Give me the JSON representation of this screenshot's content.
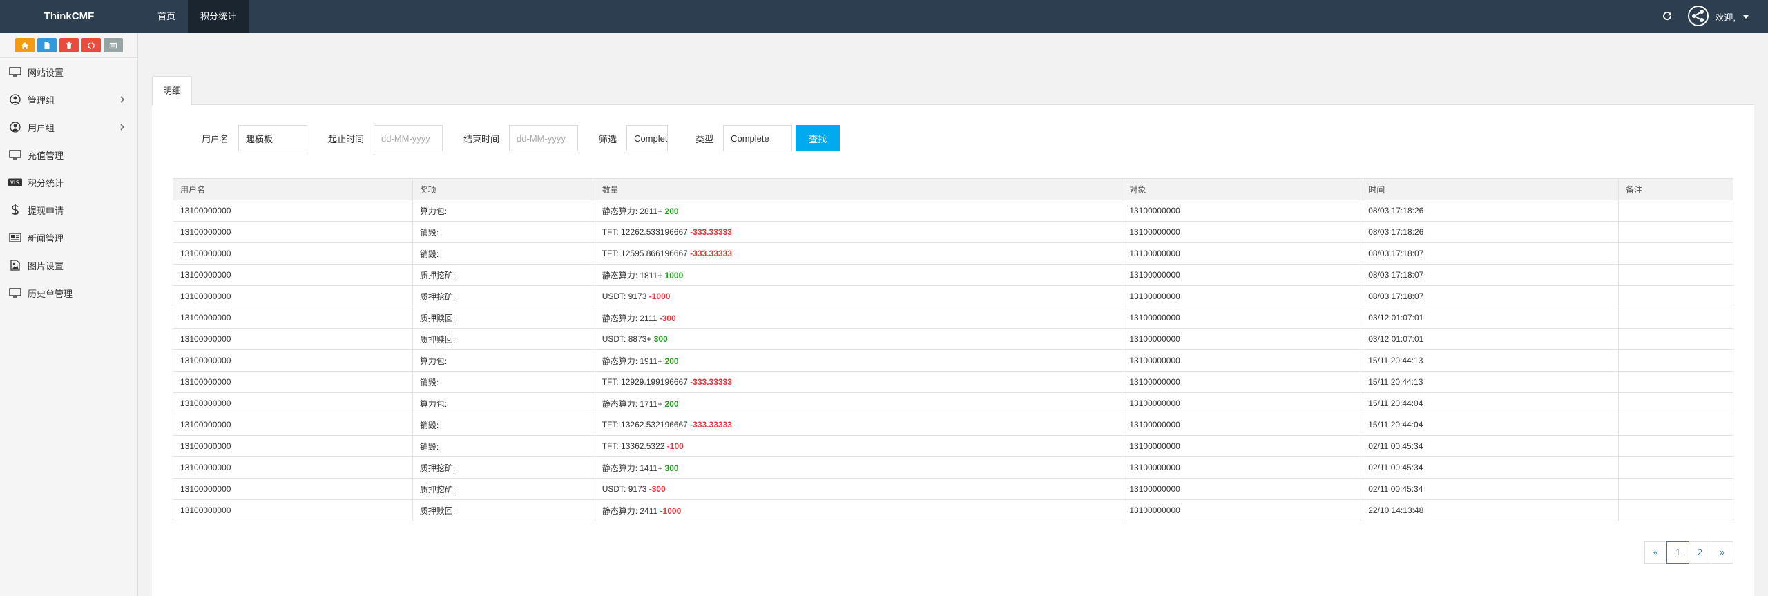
{
  "topbar": {
    "brand": "ThinkCMF",
    "nav": [
      {
        "label": "首页",
        "active": false
      },
      {
        "label": "积分统计",
        "active": true
      }
    ],
    "user_label": "欢迎,"
  },
  "sidebar": {
    "shortcuts": [
      {
        "icon": "home-icon",
        "color": "#f39c12"
      },
      {
        "icon": "file-icon",
        "color": "#3498db"
      },
      {
        "icon": "trash-icon",
        "color": "#e74c3c"
      },
      {
        "icon": "recycle-icon",
        "color": "#e74c3c"
      },
      {
        "icon": "list-icon",
        "color": "#95a5a6"
      }
    ],
    "items": [
      {
        "label": "网站设置",
        "icon": "monitor-icon",
        "has_children": false
      },
      {
        "label": "管理组",
        "icon": "user-circle-icon",
        "has_children": true
      },
      {
        "label": "用户组",
        "icon": "user-circle-icon",
        "has_children": true
      },
      {
        "label": "充值管理",
        "icon": "monitor-icon",
        "has_children": false
      },
      {
        "label": "积分统计",
        "icon": "visa-card-icon",
        "has_children": false
      },
      {
        "label": "提现申请",
        "icon": "dollar-icon",
        "has_children": false
      },
      {
        "label": "新闻管理",
        "icon": "newspaper-icon",
        "has_children": false
      },
      {
        "label": "图片设置",
        "icon": "image-icon",
        "has_children": false
      },
      {
        "label": "历史单管理",
        "icon": "monitor-icon",
        "has_children": false
      }
    ]
  },
  "tab": {
    "label": "明细"
  },
  "filters": {
    "username_label": "用户名",
    "username_value": "趣横板",
    "start_label": "起止时间",
    "start_placeholder": "dd-MM-yyyy",
    "end_label": "结束时间",
    "end_placeholder": "dd-MM-yyyy",
    "filter_label": "筛选",
    "filter_value": "Complete",
    "type_label": "类型",
    "type_value": "Complete",
    "search_label": "查找"
  },
  "table": {
    "columns": [
      "用户名",
      "奖项",
      "数量",
      "对象",
      "时间",
      "备注"
    ],
    "rows": [
      {
        "user": "13100000000",
        "item": "算力包:",
        "qty": "静态算力: 2811+",
        "delta": "200",
        "sign": "pos",
        "target": "13100000000",
        "time": "08/03 17:18:26",
        "note": ""
      },
      {
        "user": "13100000000",
        "item": "销毁:",
        "qty": "TFT: 12262.533196667",
        "delta": "-333.33333",
        "sign": "neg",
        "target": "13100000000",
        "time": "08/03 17:18:26",
        "note": ""
      },
      {
        "user": "13100000000",
        "item": "销毁:",
        "qty": "TFT: 12595.866196667",
        "delta": "-333.33333",
        "sign": "neg",
        "target": "13100000000",
        "time": "08/03 17:18:07",
        "note": ""
      },
      {
        "user": "13100000000",
        "item": "质押挖矿:",
        "qty": "静态算力: 1811+",
        "delta": "1000",
        "sign": "pos",
        "target": "13100000000",
        "time": "08/03 17:18:07",
        "note": ""
      },
      {
        "user": "13100000000",
        "item": "质押挖矿:",
        "qty": "USDT: 9173",
        "delta": "-1000",
        "sign": "neg",
        "target": "13100000000",
        "time": "08/03 17:18:07",
        "note": ""
      },
      {
        "user": "13100000000",
        "item": "质押赎回:",
        "qty": "静态算力: 2111",
        "delta": "-300",
        "sign": "neg",
        "target": "13100000000",
        "time": "03/12 01:07:01",
        "note": ""
      },
      {
        "user": "13100000000",
        "item": "质押赎回:",
        "qty": "USDT: 8873+",
        "delta": "300",
        "sign": "pos",
        "target": "13100000000",
        "time": "03/12 01:07:01",
        "note": ""
      },
      {
        "user": "13100000000",
        "item": "算力包:",
        "qty": "静态算力: 1911+",
        "delta": "200",
        "sign": "pos",
        "target": "13100000000",
        "time": "15/11 20:44:13",
        "note": ""
      },
      {
        "user": "13100000000",
        "item": "销毁:",
        "qty": "TFT: 12929.199196667",
        "delta": "-333.33333",
        "sign": "neg",
        "target": "13100000000",
        "time": "15/11 20:44:13",
        "note": ""
      },
      {
        "user": "13100000000",
        "item": "算力包:",
        "qty": "静态算力: 1711+",
        "delta": "200",
        "sign": "pos",
        "target": "13100000000",
        "time": "15/11 20:44:04",
        "note": ""
      },
      {
        "user": "13100000000",
        "item": "销毁:",
        "qty": "TFT: 13262.532196667",
        "delta": "-333.33333",
        "sign": "neg",
        "target": "13100000000",
        "time": "15/11 20:44:04",
        "note": ""
      },
      {
        "user": "13100000000",
        "item": "销毁:",
        "qty": "TFT: 13362.5322",
        "delta": "-100",
        "sign": "neg",
        "target": "13100000000",
        "time": "02/11 00:45:34",
        "note": ""
      },
      {
        "user": "13100000000",
        "item": "质押挖矿:",
        "qty": "静态算力: 1411+",
        "delta": "300",
        "sign": "pos",
        "target": "13100000000",
        "time": "02/11 00:45:34",
        "note": ""
      },
      {
        "user": "13100000000",
        "item": "质押挖矿:",
        "qty": "USDT: 9173",
        "delta": "-300",
        "sign": "neg",
        "target": "13100000000",
        "time": "02/11 00:45:34",
        "note": ""
      },
      {
        "user": "13100000000",
        "item": "质押赎回:",
        "qty": "静态算力: 2411",
        "delta": "-1000",
        "sign": "neg",
        "target": "13100000000",
        "time": "22/10 14:13:48",
        "note": ""
      }
    ]
  },
  "pagination": {
    "prev": "«",
    "pages": [
      "1",
      "2"
    ],
    "current": "1",
    "next": "»"
  },
  "colors": {
    "topbar_bg": "#2c3e50",
    "search_button": "#00aaee",
    "positive": "#1e9b1e",
    "negative": "#e4393c"
  }
}
